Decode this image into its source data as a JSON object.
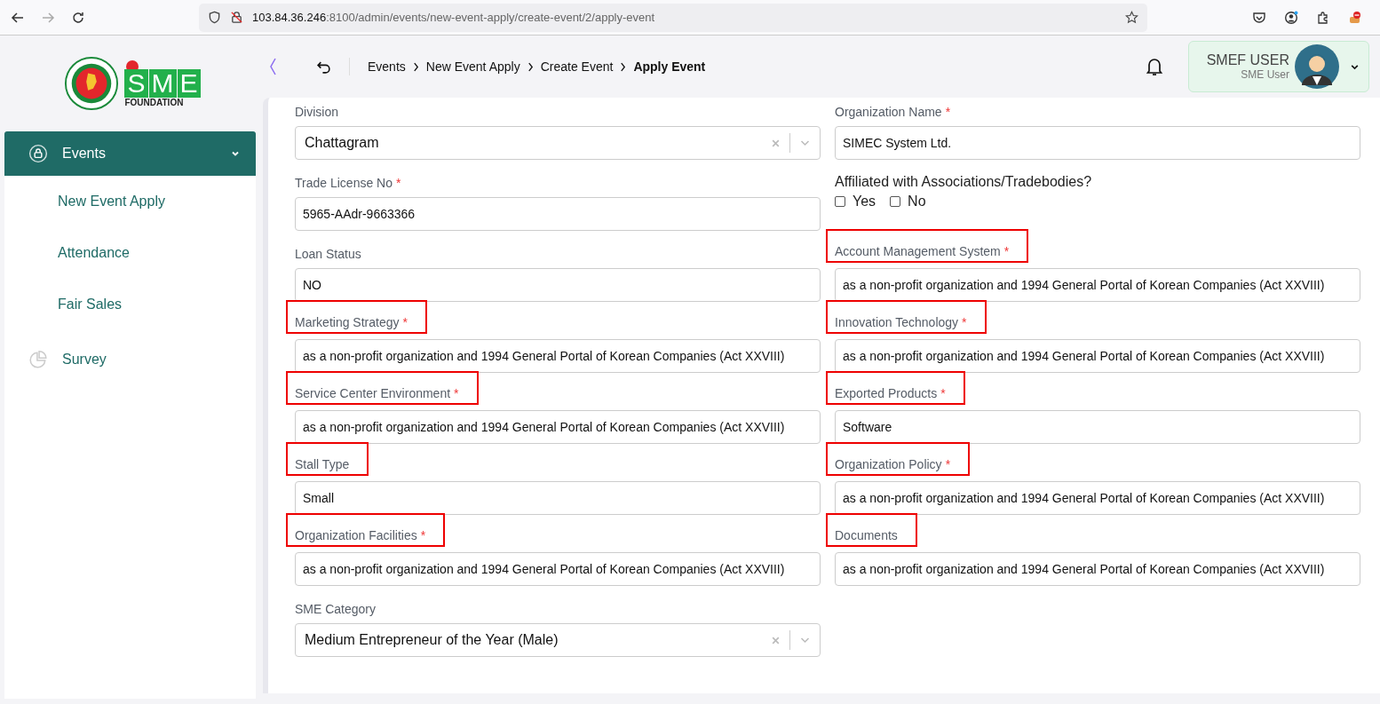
{
  "browser": {
    "url_host": "103.84.36.246",
    "url_path": ":8100/admin/events/new-event-apply/create-event/2/apply-event"
  },
  "logo": {
    "letters": [
      "S",
      "M",
      "E"
    ],
    "caption": "FOUNDATION"
  },
  "sidebar": {
    "items": [
      {
        "label": "Events",
        "selected": true,
        "expanded": true,
        "children": [
          {
            "label": "New Event Apply"
          },
          {
            "label": "Attendance"
          },
          {
            "label": "Fair Sales"
          }
        ]
      },
      {
        "label": "Survey",
        "selected": false
      }
    ]
  },
  "breadcrumbs": [
    {
      "label": "Events",
      "current": false
    },
    {
      "label": "New Event Apply",
      "current": false
    },
    {
      "label": "Create Event",
      "current": false
    },
    {
      "label": "Apply Event",
      "current": true
    }
  ],
  "user": {
    "name": "SMEF USER",
    "role": "SME User"
  },
  "form": {
    "fields": [
      {
        "kind": "select",
        "label": "Division",
        "highlighted": false,
        "value": "Chattagram"
      },
      {
        "kind": "text",
        "label": "Organization Name",
        "required_mark": "*",
        "highlighted": false,
        "value": "SIMEC System Ltd."
      },
      {
        "kind": "text",
        "label": "Trade License No",
        "required_mark": "*",
        "highlighted": false,
        "value": "5965-AAdr-9663366"
      },
      {
        "kind": "checks",
        "label": "Affiliated with Associations/Tradebodies?",
        "highlighted": false,
        "options": [
          {
            "label": "Yes",
            "checked": false
          },
          {
            "label": "No",
            "checked": false
          }
        ]
      },
      {
        "kind": "text",
        "label": "Loan Status",
        "highlighted": false,
        "value": "NO"
      },
      {
        "kind": "text",
        "label": "Account Management System",
        "required_mark": "*",
        "highlighted": true,
        "value": "as a non-profit organization and 1994 General Portal of Korean Companies (Act XXVIII)"
      },
      {
        "kind": "text",
        "label": "Marketing Strategy",
        "required_mark": "*",
        "highlighted": true,
        "value": "as a non-profit organization and 1994 General Portal of Korean Companies (Act XXVIII)"
      },
      {
        "kind": "text",
        "label": "Innovation Technology",
        "required_mark": "*",
        "highlighted": true,
        "value": "as a non-profit organization and 1994 General Portal of Korean Companies (Act XXVIII)"
      },
      {
        "kind": "text",
        "label": "Service Center Environment",
        "required_mark": "*",
        "highlighted": true,
        "value": "as a non-profit organization and 1994 General Portal of Korean Companies (Act XXVIII)"
      },
      {
        "kind": "text",
        "label": "Exported Products",
        "required_mark": "*",
        "highlighted": true,
        "value": "Software"
      },
      {
        "kind": "text",
        "label": "Stall Type",
        "highlighted": true,
        "value": "Small"
      },
      {
        "kind": "text",
        "label": "Organization Policy",
        "required_mark": "*",
        "highlighted": true,
        "value": "as a non-profit organization and 1994 General Portal of Korean Companies (Act XXVIII)"
      },
      {
        "kind": "text",
        "label": "Organization Facilities",
        "required_mark": "*",
        "highlighted": true,
        "value": "as a non-profit organization and 1994 General Portal of Korean Companies (Act XXVIII)"
      },
      {
        "kind": "text",
        "label": "Documents",
        "highlighted": true,
        "value": "as a non-profit organization and 1994 General Portal of Korean Companies (Act XXVIII)"
      },
      {
        "kind": "select",
        "label": "SME Category",
        "highlighted": false,
        "value": "Medium Entrepreneur of the Year (Male)"
      }
    ]
  }
}
